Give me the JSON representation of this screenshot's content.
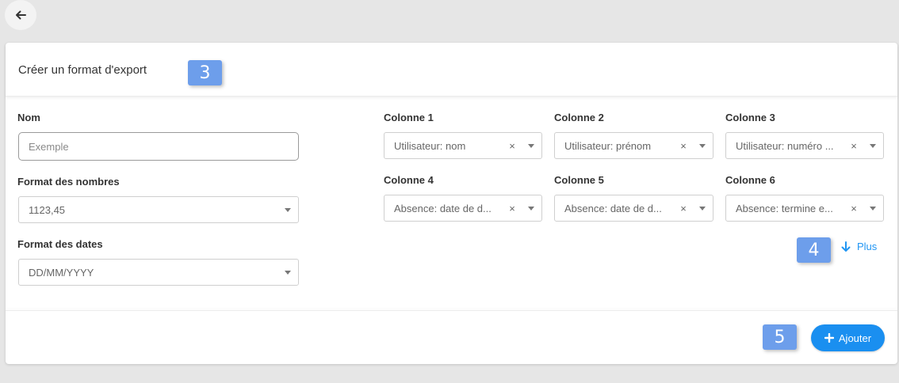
{
  "nav": {
    "back_icon": "arrow-left-icon"
  },
  "header": {
    "title": "Créer un format d'export"
  },
  "badges": {
    "step3": "3",
    "step4": "4",
    "step5": "5"
  },
  "form": {
    "name": {
      "label": "Nom",
      "value": "",
      "placeholder": "Exemple"
    },
    "number_format": {
      "label": "Format des nombres",
      "value": "1123,45"
    },
    "date_format": {
      "label": "Format des dates",
      "value": "DD/MM/YYYY"
    }
  },
  "columns": [
    {
      "label": "Colonne 1",
      "value": "Utilisateur: nom"
    },
    {
      "label": "Colonne 2",
      "value": "Utilisateur: prénom"
    },
    {
      "label": "Colonne 3",
      "value": "Utilisateur: numéro ..."
    },
    {
      "label": "Colonne 4",
      "value": "Absence: date de d..."
    },
    {
      "label": "Colonne 5",
      "value": "Absence: date de d..."
    },
    {
      "label": "Colonne 6",
      "value": "Absence: termine e..."
    }
  ],
  "clear_symbol": "×",
  "more_link": {
    "label": "Plus",
    "icon": "arrow-down-icon"
  },
  "add_button": {
    "label": "Ajouter",
    "icon": "plus-icon"
  },
  "colors": {
    "accent": "#1a8ff0",
    "badge": "#6d9eeb",
    "link": "#2196f3"
  }
}
